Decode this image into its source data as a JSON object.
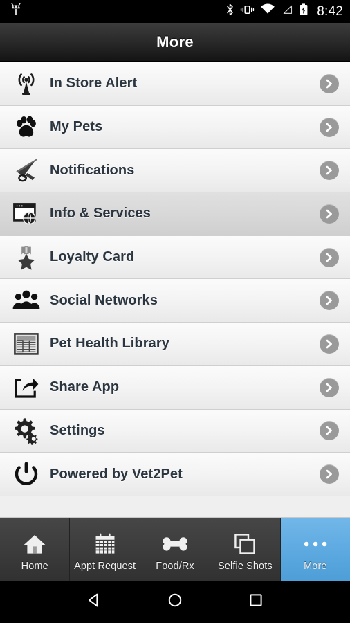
{
  "statusbar": {
    "clock": "8:42",
    "left_icons": [
      "android-robot-icon"
    ],
    "right_icons": [
      "bluetooth-icon",
      "vibrate-icon",
      "wifi-icon",
      "cellular-signal-icon",
      "battery-charging-icon"
    ]
  },
  "header": {
    "title": "More"
  },
  "colors": {
    "accent": "#5dace0",
    "list_text": "#2b3640",
    "chevron": "#9a9a9a",
    "titlebar_top": "#3c3c3c",
    "titlebar_bottom": "#141414",
    "tabbar": "#3b3b3b",
    "row_active": "#d8d8d8"
  },
  "list": {
    "items": [
      {
        "label": "In Store Alert",
        "icon": "broadcast-antenna-icon",
        "active": false
      },
      {
        "label": "My Pets",
        "icon": "paw-print-icon",
        "active": false
      },
      {
        "label": "Notifications",
        "icon": "megaphone-icon",
        "active": false
      },
      {
        "label": "Info & Services",
        "icon": "browser-globe-icon",
        "active": true
      },
      {
        "label": "Loyalty Card",
        "icon": "medal-star-icon",
        "active": false
      },
      {
        "label": "Social Networks",
        "icon": "people-group-icon",
        "active": false
      },
      {
        "label": "Pet Health Library",
        "icon": "spreadsheet-table-icon",
        "active": false
      },
      {
        "label": "Share App",
        "icon": "share-arrow-icon",
        "active": false
      },
      {
        "label": "Settings",
        "icon": "gears-icon",
        "active": false
      },
      {
        "label": "Powered by Vet2Pet",
        "icon": "power-button-icon",
        "active": false
      }
    ],
    "chevron_icon": "chevron-right-icon"
  },
  "tabbar": {
    "tabs": [
      {
        "label": "Home",
        "icon": "house-icon",
        "selected": false
      },
      {
        "label": "Appt Request",
        "icon": "calendar-icon",
        "selected": false
      },
      {
        "label": "Food/Rx",
        "icon": "bone-icon",
        "selected": false
      },
      {
        "label": "Selfie Shots",
        "icon": "stacked-photos-icon",
        "selected": false
      },
      {
        "label": "More",
        "icon": "ellipsis-icon",
        "selected": true
      }
    ]
  },
  "navbar": {
    "buttons": [
      {
        "name": "back-button",
        "icon": "triangle-back-icon"
      },
      {
        "name": "home-button",
        "icon": "circle-home-icon"
      },
      {
        "name": "recents-button",
        "icon": "square-recents-icon"
      }
    ]
  }
}
